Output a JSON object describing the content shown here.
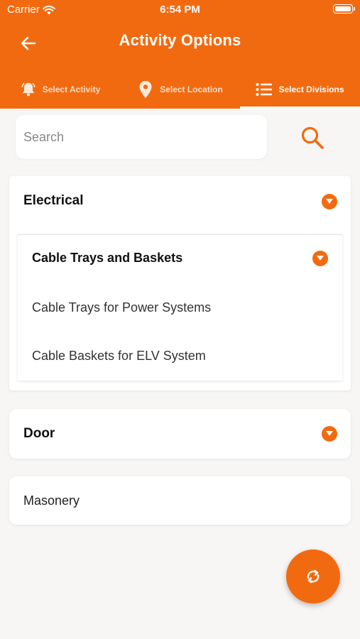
{
  "status_bar": {
    "carrier": "Carrier",
    "time": "6:54 PM"
  },
  "header": {
    "title": "Activity Options",
    "back_icon": "arrow-left-icon"
  },
  "tabs": [
    {
      "label": "Select Activity",
      "icon": "bell-icon",
      "active": false
    },
    {
      "label": "Select Location",
      "icon": "location-pin-icon",
      "active": false
    },
    {
      "label": "Select Divisions",
      "icon": "list-icon",
      "active": true
    }
  ],
  "search": {
    "placeholder": "Search",
    "value": ""
  },
  "divisions": {
    "electrical": {
      "title": "Electrical",
      "sub": {
        "title": "Cable Trays and Baskets",
        "items": [
          "Cable Trays for Power Systems",
          "Cable Baskets for ELV System"
        ]
      }
    },
    "door": {
      "title": "Door"
    },
    "masonry": {
      "title": "Masonery"
    }
  },
  "colors": {
    "accent": "#f26a10",
    "background": "#f7f6f5",
    "card": "#ffffff"
  }
}
